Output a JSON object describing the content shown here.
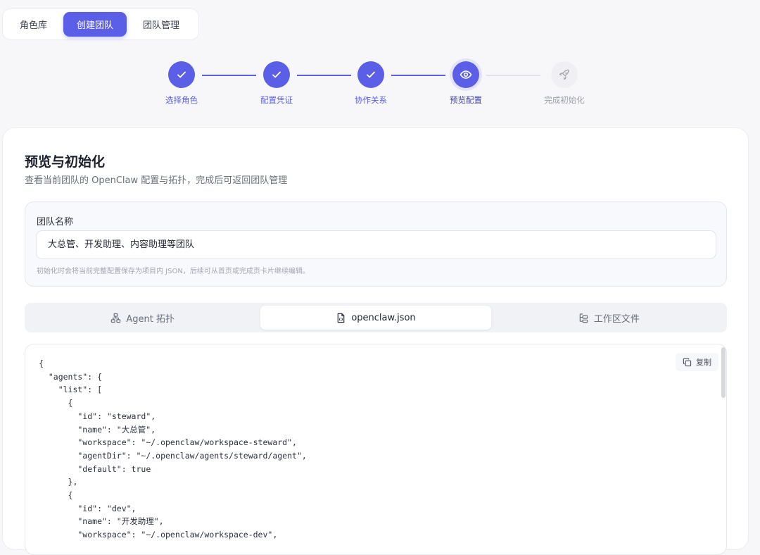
{
  "nav": {
    "tabs": [
      {
        "label": "角色库"
      },
      {
        "label": "创建团队"
      },
      {
        "label": "团队管理"
      }
    ]
  },
  "stepper": {
    "steps": [
      {
        "label": "选择角色",
        "state": "done",
        "icon": "check-icon"
      },
      {
        "label": "配置凭证",
        "state": "done",
        "icon": "check-icon"
      },
      {
        "label": "协作关系",
        "state": "done",
        "icon": "check-icon"
      },
      {
        "label": "预览配置",
        "state": "current",
        "icon": "eye-icon"
      },
      {
        "label": "完成初始化",
        "state": "pending",
        "icon": "rocket-icon"
      }
    ]
  },
  "page": {
    "title": "预览与初始化",
    "subtitle": "查看当前团队的 OpenClaw 配置与拓扑，完成后可返回团队管理"
  },
  "team_name": {
    "label": "团队名称",
    "value": "大总管、开发助理、内容助理等团队",
    "hint": "初始化时会将当前完整配置保存为项目内 JSON，后续可从首页或完成页卡片继续编辑。"
  },
  "view_tabs": [
    {
      "label": "Agent 拓扑",
      "icon": "topology-icon"
    },
    {
      "label": "openclaw.json",
      "icon": "json-file-icon"
    },
    {
      "label": "工作区文件",
      "icon": "folder-tree-icon"
    }
  ],
  "code": {
    "copy_label": "复制",
    "content": "{\n  \"agents\": {\n    \"list\": [\n      {\n        \"id\": \"steward\",\n        \"name\": \"大总管\",\n        \"workspace\": \"~/.openclaw/workspace-steward\",\n        \"agentDir\": \"~/.openclaw/agents/steward/agent\",\n        \"default\": true\n      },\n      {\n        \"id\": \"dev\",\n        \"name\": \"开发助理\",\n        \"workspace\": \"~/.openclaw/workspace-dev\","
  },
  "colors": {
    "accent": "#5b5ee6",
    "pending": "#e2e3ea"
  }
}
